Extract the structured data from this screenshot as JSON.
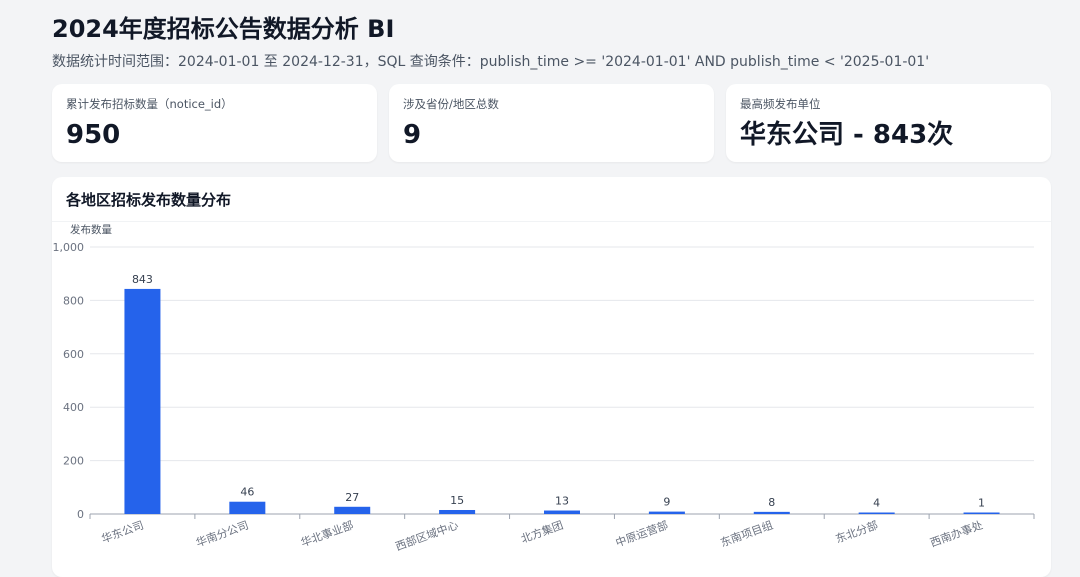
{
  "header": {
    "title": "2024年度招标公告数据分析 BI",
    "subtitle": "数据统计时间范围：2024-01-01 至 2024-12-31，SQL 查询条件：publish_time >= '2024-01-01' AND publish_time < '2025-01-01'"
  },
  "cards": [
    {
      "label": "累计发布招标数量（notice_id）",
      "value": "950"
    },
    {
      "label": "涉及省份/地区总数",
      "value": "9"
    },
    {
      "label": "最高频发布单位",
      "value": "华东公司 - 843次"
    }
  ],
  "panel": {
    "title": "各地区招标发布数量分布"
  },
  "colors": {
    "bar": "#2563eb",
    "grid": "#e5e7eb",
    "axis": "#9ca3af"
  },
  "chart_data": {
    "type": "bar",
    "title": "各地区招标发布数量分布",
    "ylabel": "发布数量",
    "xlabel": "",
    "ylim": [
      0,
      1000
    ],
    "yticks": [
      0,
      200,
      400,
      600,
      800,
      1000
    ],
    "ytick_labels": [
      "0",
      "200",
      "400",
      "600",
      "800",
      "1,000"
    ],
    "grid": true,
    "categories": [
      "华东公司",
      "华南分公司",
      "华北事业部",
      "西部区域中心",
      "北方集团",
      "中原运营部",
      "东南项目组",
      "东北分部",
      "西南办事处"
    ],
    "values": [
      843,
      46,
      27,
      15,
      13,
      9,
      8,
      4,
      1
    ],
    "data_labels": true
  }
}
